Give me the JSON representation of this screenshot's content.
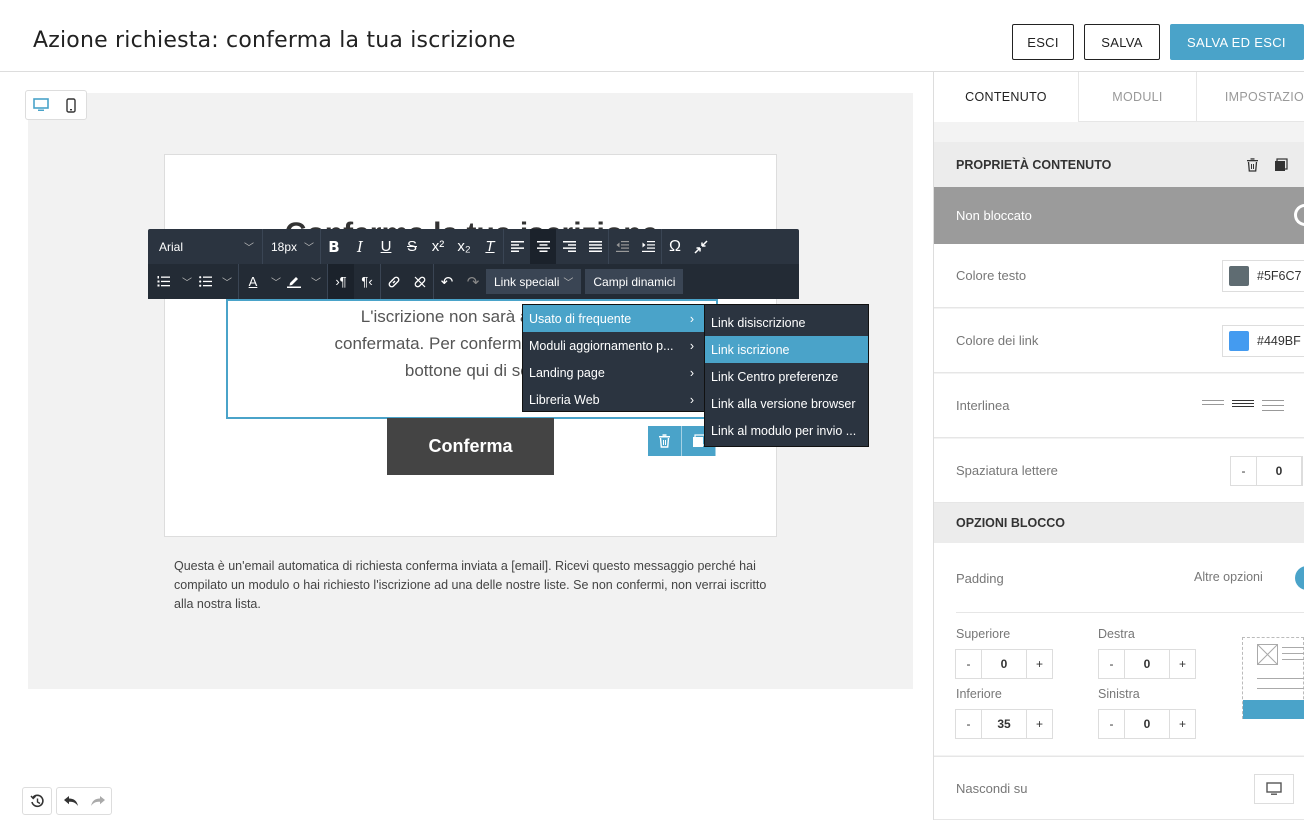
{
  "header": {
    "title": "Azione richiesta: conferma la tua iscrizione",
    "exit_label": "ESCI",
    "save_label": "SALVA",
    "save_exit_label": "SALVA ED ESCI"
  },
  "email": {
    "heading": "Conferma la tua iscrizione",
    "body_line1": "L'iscrizione non sarà attiva fin",
    "body_line2": "confermata. Per confermare la tua is",
    "body_line3": "bottone qui di seg",
    "button_label": "Conferma",
    "footer": "Questa è un'email automatica di richiesta conferma inviata a [email]. Ricevi questo messaggio perché hai compilato un modulo o hai richiesto l'iscrizione ad una delle nostre liste. Se non confermi, non verrai iscritto alla nostra lista."
  },
  "toolbar": {
    "font": "Arial",
    "size": "18px",
    "special_links": "Link speciali",
    "dynamic_fields": "Campi dinamici"
  },
  "menu": {
    "items": [
      {
        "label": "Usato di frequente"
      },
      {
        "label": "Moduli aggiornamento p..."
      },
      {
        "label": "Landing page"
      },
      {
        "label": "Libreria Web"
      }
    ],
    "submenu": [
      {
        "label": "Link disiscrizione"
      },
      {
        "label": "Link iscrizione"
      },
      {
        "label": "Link Centro preferenze"
      },
      {
        "label": "Link alla versione browser"
      },
      {
        "label": "Link al modulo per invio ..."
      }
    ]
  },
  "panel": {
    "tabs": [
      {
        "label": "CONTENUTO"
      },
      {
        "label": "MODULI"
      },
      {
        "label": "IMPOSTAZIO"
      }
    ],
    "content_props": "PROPRIETÀ CONTENUTO",
    "not_locked": "Non bloccato",
    "text_color_label": "Colore testo",
    "text_color_value": "#5F6C7",
    "text_color_swatch": "#5f6c72",
    "link_color_label": "Colore dei link",
    "link_color_value": "#449BF",
    "link_color_swatch": "#449bf0",
    "line_height_label": "Interlinea",
    "letter_spacing_label": "Spaziatura lettere",
    "letter_spacing_value": "0",
    "block_options": "OPZIONI BLOCCO",
    "padding_label": "Padding",
    "more_options": "Altre opzioni",
    "top_label": "Superiore",
    "top_value": "0",
    "right_label": "Destra",
    "right_value": "0",
    "bottom_label": "Inferiore",
    "bottom_value": "35",
    "left_label": "Sinistra",
    "left_value": "0",
    "hide_on_label": "Nascondi su"
  },
  "colors": {
    "accent": "#4aa3c9",
    "toolbar": "#2b3440"
  }
}
